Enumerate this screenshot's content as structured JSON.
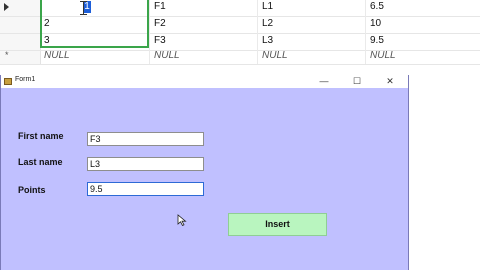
{
  "grid": {
    "rows": [
      {
        "indicator": "current",
        "cells": [
          "1",
          "F1",
          "L1",
          "6.5"
        ]
      },
      {
        "indicator": "",
        "cells": [
          "2",
          "F2",
          "L2",
          "10"
        ]
      },
      {
        "indicator": "",
        "cells": [
          "3",
          "F3",
          "L3",
          "9.5"
        ]
      },
      {
        "indicator": "new",
        "cells": [
          "NULL",
          "NULL",
          "NULL",
          "NULL"
        ]
      }
    ],
    "new_row_marker": "*"
  },
  "form": {
    "title": "Form1",
    "controls": {
      "minimize": "—",
      "maximize": "☐",
      "close": "✕"
    },
    "first_name_label": "First name",
    "first_name_value": "F3",
    "last_name_label": "Last name",
    "last_name_value": "L3",
    "points_label": "Points",
    "points_value": "9.5",
    "insert_label": "Insert"
  },
  "colors": {
    "form_bg": "#c0c0ff",
    "insert_bg": "#b9f5bf",
    "selection": "#3aa54a"
  }
}
